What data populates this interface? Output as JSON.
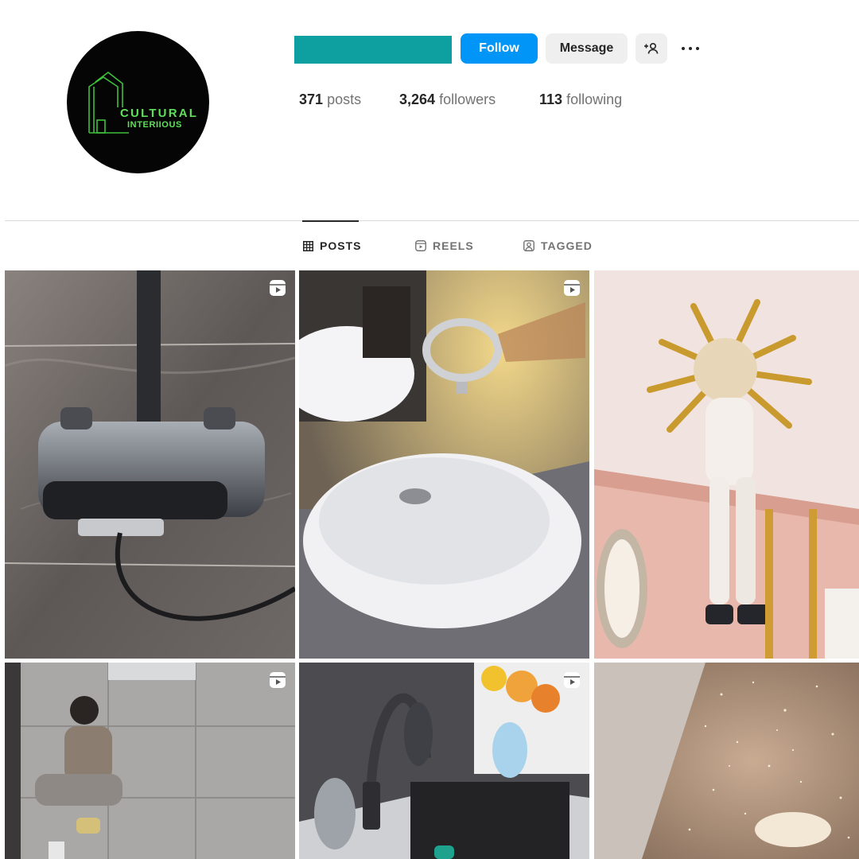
{
  "profile": {
    "logo_text_line1": "CULTURAL",
    "logo_text_line2": "INTERIIOUS",
    "username_redaction_color": "#0e9fa0"
  },
  "actions": {
    "follow_label": "Follow",
    "message_label": "Message",
    "add_user_icon": "person-add-icon",
    "more_icon": "more-horizontal-icon"
  },
  "stats": {
    "posts_count": "371",
    "posts_label": "posts",
    "followers_count": "3,264",
    "followers_label": "followers",
    "following_count": "113",
    "following_label": "following"
  },
  "tabs": [
    {
      "label": "POSTS",
      "icon": "grid-icon",
      "active": true
    },
    {
      "label": "REELS",
      "icon": "reels-icon",
      "active": false
    },
    {
      "label": "TAGGED",
      "icon": "tagged-icon",
      "active": false
    }
  ],
  "posts": [
    {
      "subject": "wall-mounted shower mixer",
      "is_reel": true
    },
    {
      "subject": "vessel sink with faucet",
      "is_reel": true
    },
    {
      "subject": "gold sunburst ceiling installation",
      "is_reel": false
    },
    {
      "subject": "man installing floor tiles",
      "is_reel": true
    },
    {
      "subject": "kitchen sink faucet with bear figures",
      "is_reel": true
    },
    {
      "subject": "starry ceiling",
      "is_reel": false
    }
  ],
  "colors": {
    "accent": "#0095f6",
    "secondary_button": "#efefef",
    "text_primary": "#262626",
    "text_secondary": "#737373",
    "divider": "#dbdbdb"
  }
}
